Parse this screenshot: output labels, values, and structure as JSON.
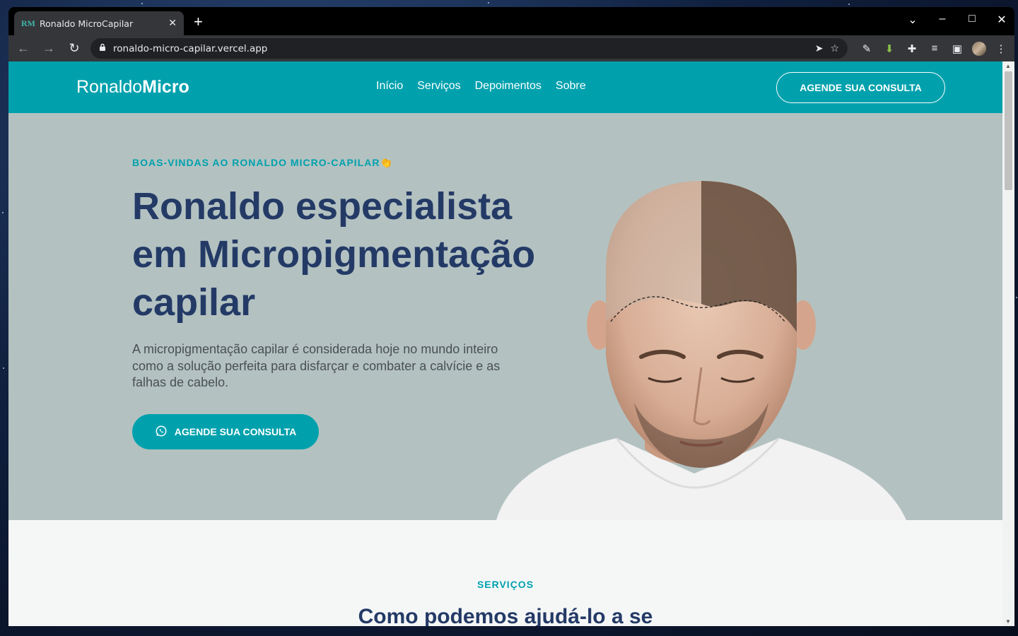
{
  "browser": {
    "tab_title": "Ronaldo MicroCapilar",
    "favicon_text": "RM",
    "url": "ronaldo-micro-capilar.vercel.app"
  },
  "site": {
    "logo_regular": "Ronaldo",
    "logo_bold": "Micro",
    "nav": [
      "Início",
      "Serviços",
      "Depoimentos",
      "Sobre"
    ],
    "nav_cta": "AGENDE SUA CONSULTA"
  },
  "hero": {
    "eyebrow": "BOAS-VINDAS AO RONALDO MICRO-CAPILAR👏",
    "headline": "Ronaldo especialista em Micropigmentação capilar",
    "lead": "A micropigmentação capilar é considerada hoje no mundo inteiro como a solução perfeita para disfarçar e combater a calvície e as falhas de cabelo.",
    "cta": "AGENDE SUA CONSULTA",
    "cta_icon": "whatsapp-icon",
    "image": "bald-man-before-after-icon"
  },
  "services": {
    "eyebrow": "SERVIÇOS",
    "title": "Como podemos ajudá-lo a se"
  },
  "colors": {
    "brand": "#00a1ad",
    "heading": "#243a66",
    "hero_bg": "#b3c2c1"
  }
}
